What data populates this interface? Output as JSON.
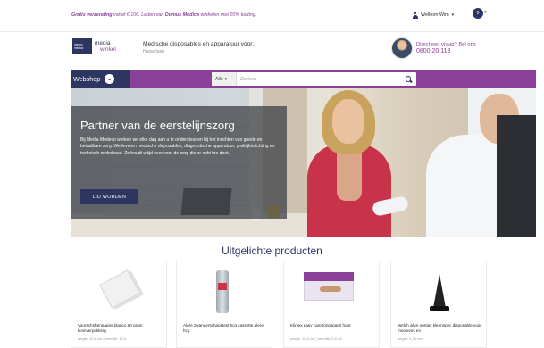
{
  "promo": {
    "bold": "Gratis verzending",
    "rest": " vanaf € 100. Leden van ",
    "brand": "Domus Medica",
    "tail": " winkelen met 20% korting."
  },
  "account": {
    "label": "Welkom Wim"
  },
  "cart": {
    "count": "0"
  },
  "logo": {
    "box_line1": "domus",
    "box_line2": "medica",
    "line1": "media",
    "line2": "winkel"
  },
  "tagline": {
    "main": "Medische disposables en apparatuur voor:",
    "sub": "Huisartsen"
  },
  "contact": {
    "line1": "Direct een vraag? Bel ons",
    "phone": "0800 20 113"
  },
  "nav": {
    "webshop_label": "Webshop"
  },
  "search": {
    "category": "Alle",
    "placeholder": "Zoeken"
  },
  "hero": {
    "title": "Partner van de eerstelijnszorg",
    "body": "Bij Media Medeco werken we elke dag aan u te ondersteunen bij het inrichten van goede en betaalbare zorg. We leveren medische disposables, diagnostische apparatuur, praktijkinrichting en technisch onderhoud. Zo houdt u tijd over voor de zorg die er echt toe doet.",
    "button_label": "LID WORDEN"
  },
  "featured": {
    "title": "Uitgelichte producten",
    "products": [
      {
        "name": "Voorschriftenpapier blanco 60 gram kleinverpakking",
        "spec": "lengte: 20,8 cm | breedte: 10,5"
      },
      {
        "name": "Alere zwangerschapstest hcg cassette alere hcg",
        "spec": ""
      },
      {
        "name": "Kliniex easy care tongspatel hout",
        "spec": "lengte: 15,0 cm | breedte: 2,0 cm"
      },
      {
        "name": "Welch allyn oortips kleenspec disposable voor mooievos en",
        "spec": "lengte: 2,75 mm"
      }
    ]
  },
  "colors": {
    "navy": "#2d3561",
    "purple": "#8a3f98"
  }
}
